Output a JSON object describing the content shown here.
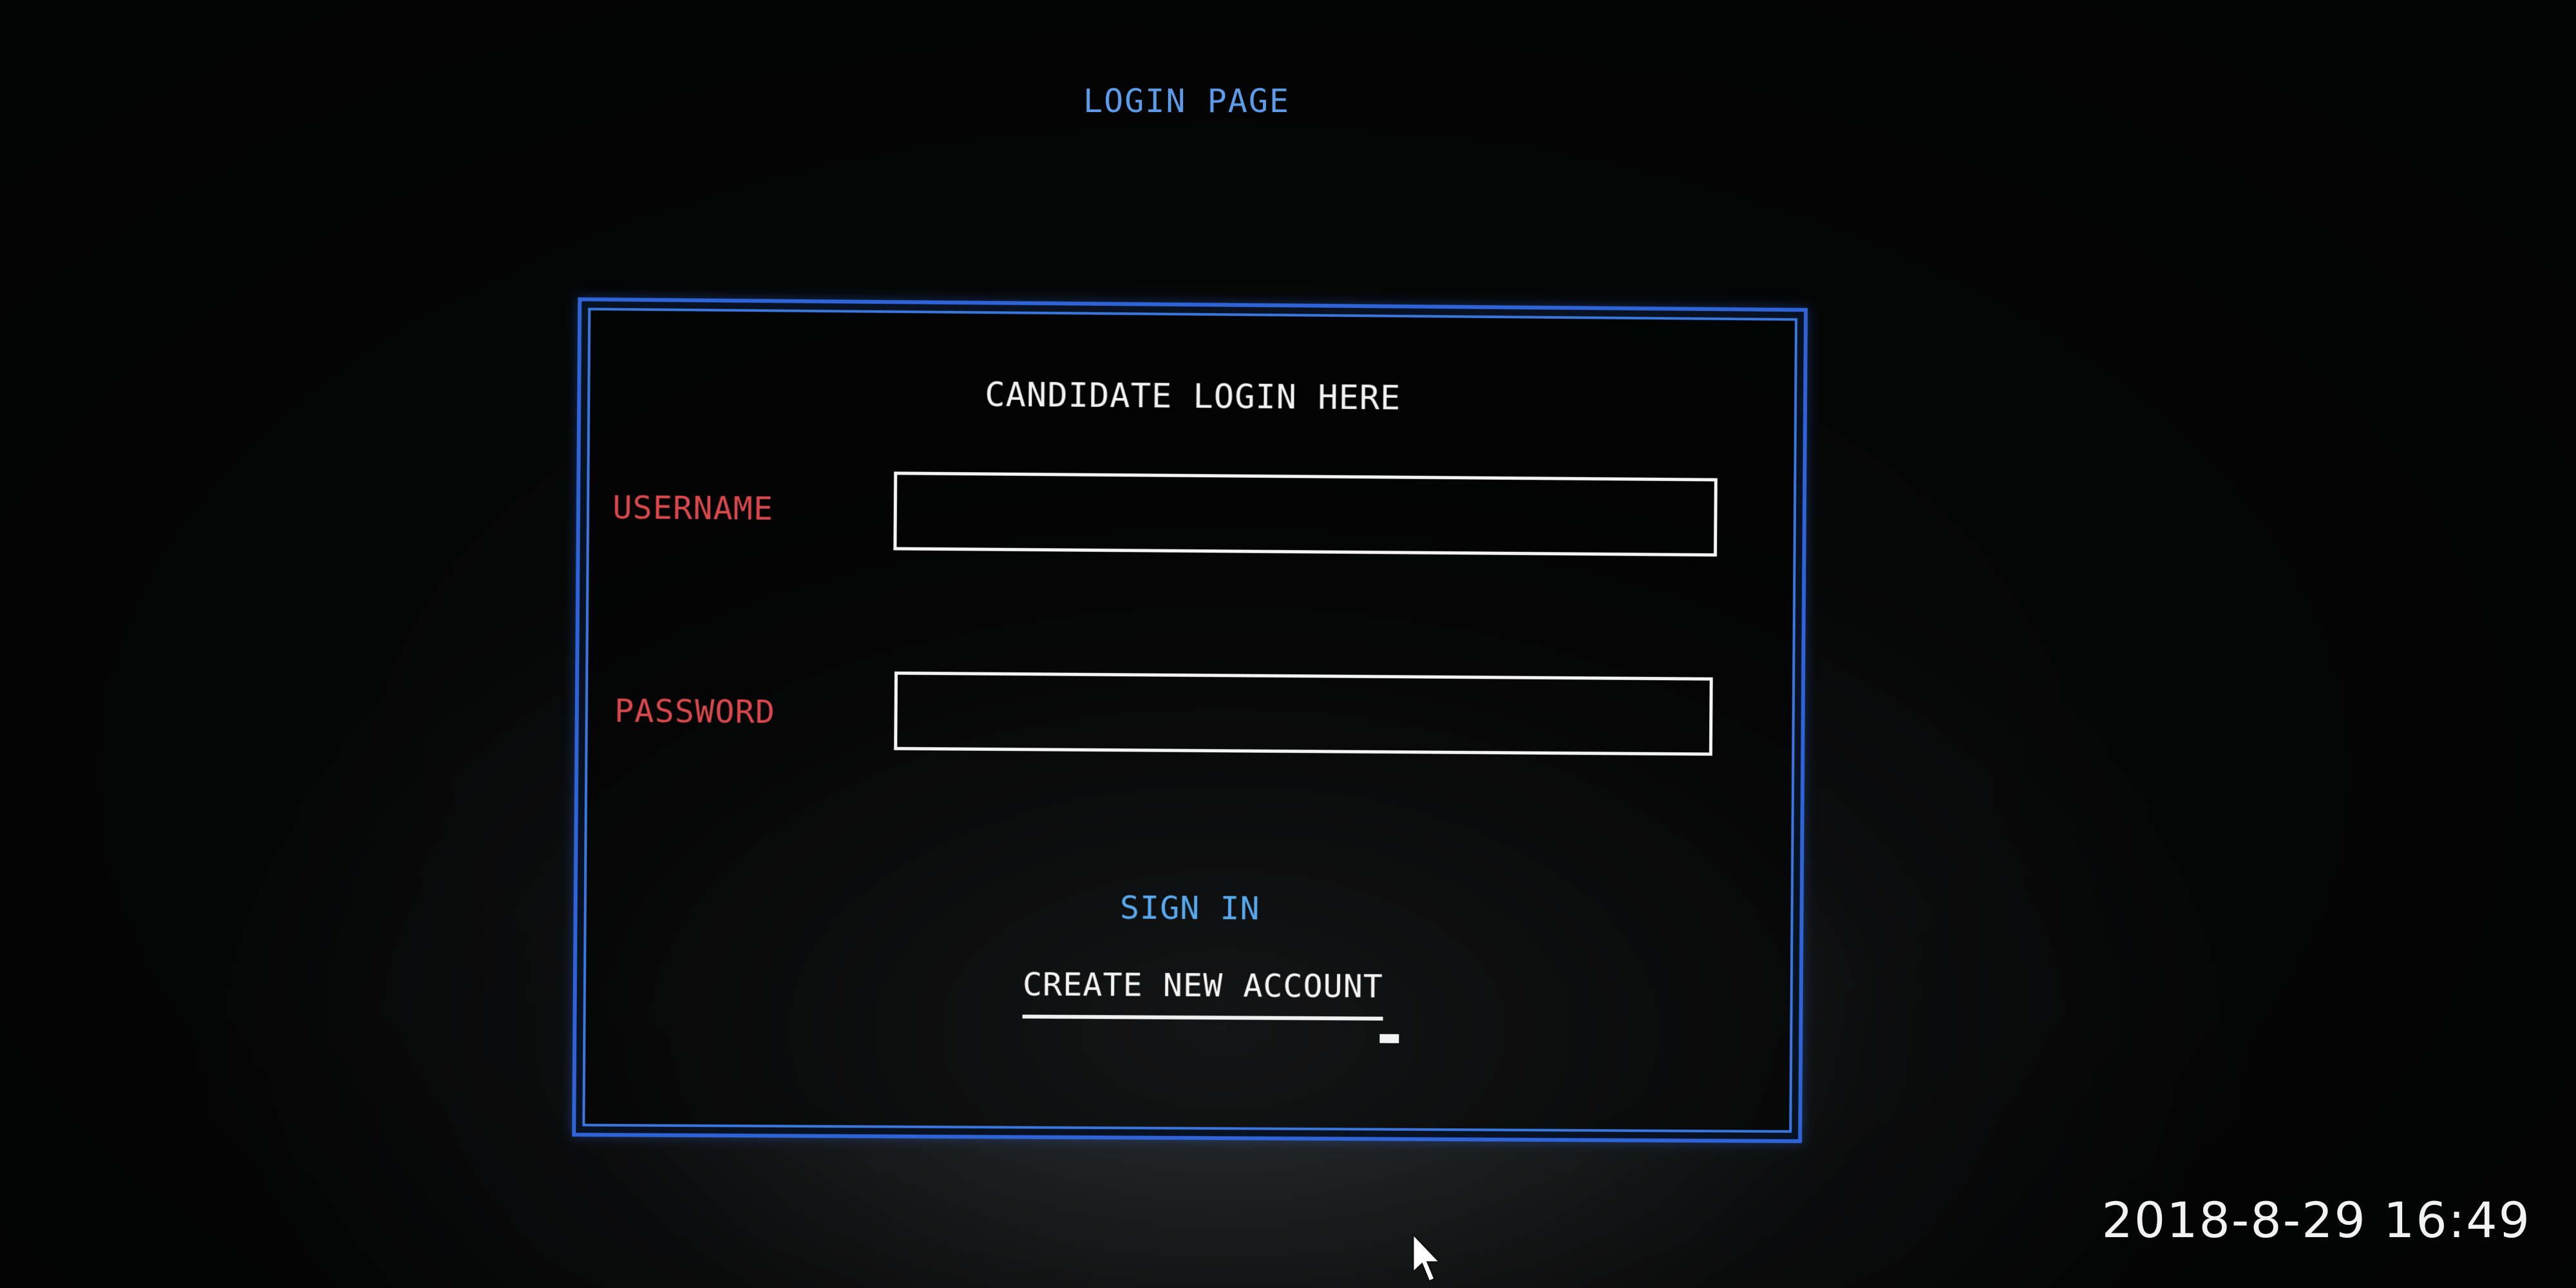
{
  "page": {
    "title": "LOGIN PAGE"
  },
  "login_form": {
    "heading": "CANDIDATE LOGIN HERE",
    "username_label": "USERNAME",
    "password_label": "PASSWORD",
    "username_value": "",
    "password_value": "",
    "sign_in_label": "SIGN IN",
    "create_account_label": "CREATE NEW ACCOUNT"
  },
  "photo_overlay": {
    "timestamp": "2018-8-29 16:49"
  },
  "colors": {
    "title": "#5b9be8",
    "panel_border": "#2f63d8",
    "field_label": "#d8484c",
    "sign_in": "#58a9ee",
    "heading": "#f2f2f2",
    "background": "#060707"
  },
  "icons": {
    "pointer": "mouse-pointer-icon"
  }
}
